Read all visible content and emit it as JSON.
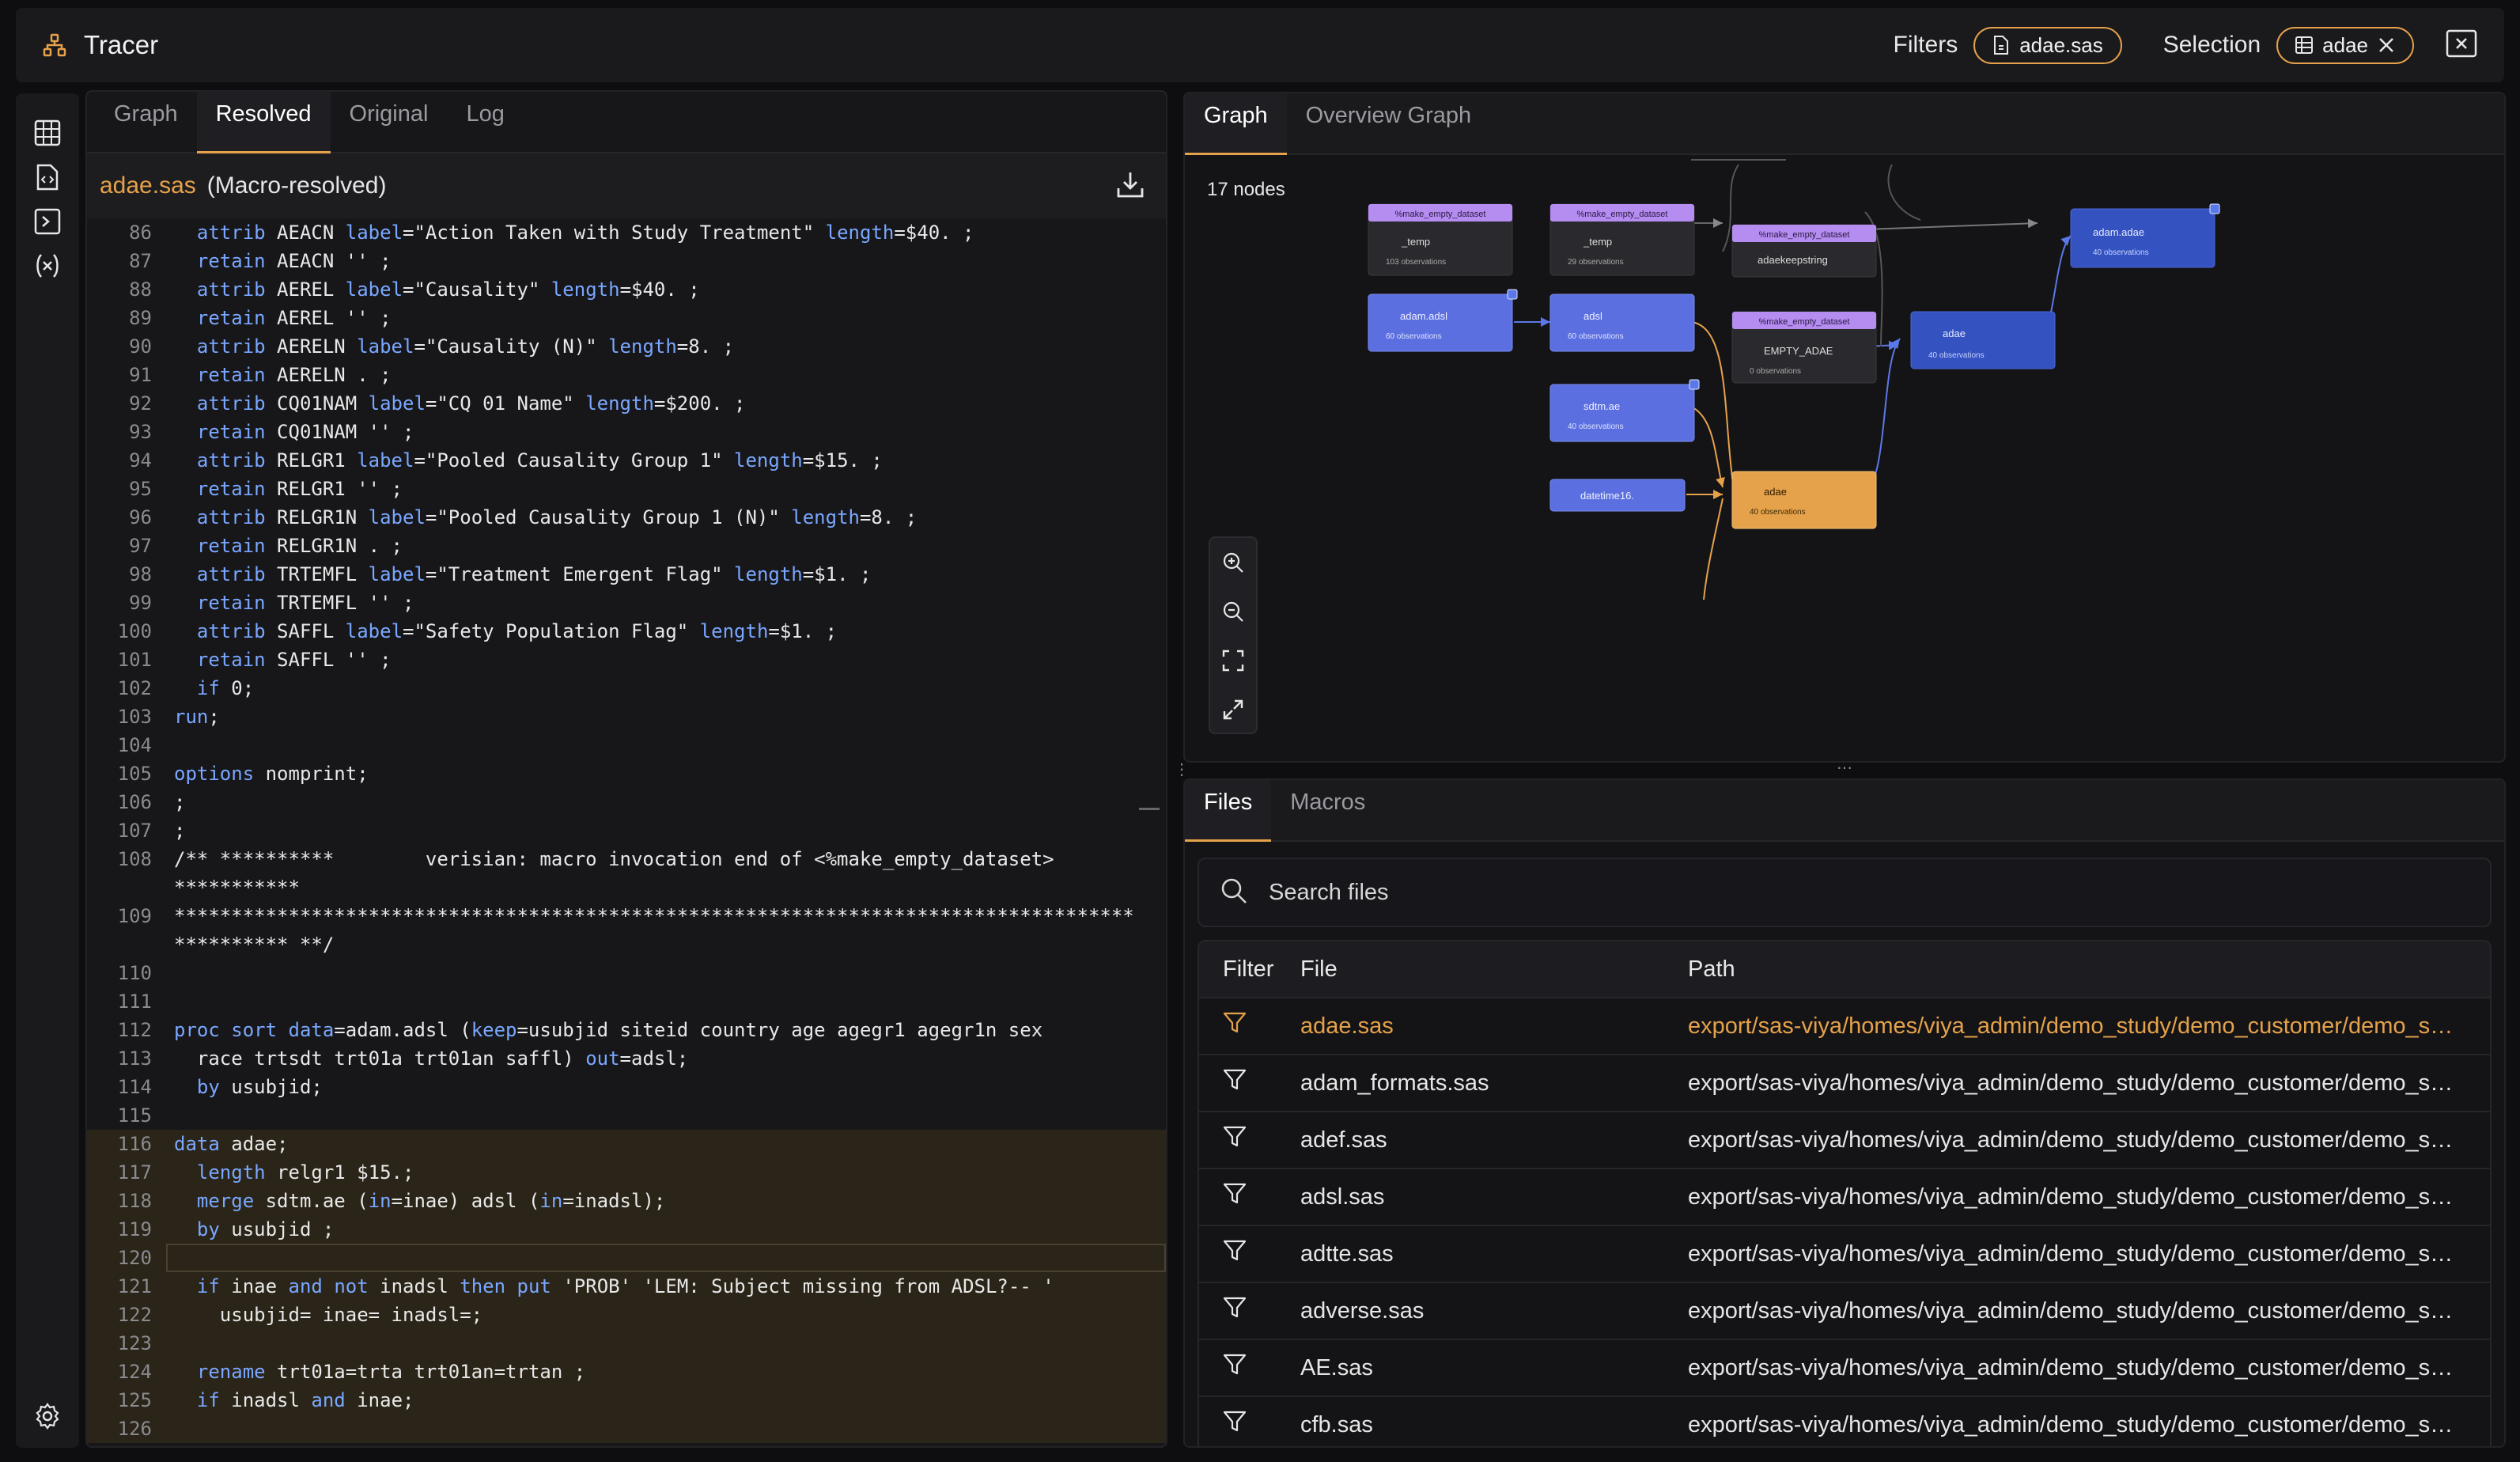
{
  "app": {
    "title": "Tracer",
    "filters_label": "Filters",
    "filter_value": "adae.sas",
    "selection_label": "Selection",
    "selection_value": "adae"
  },
  "code_panel": {
    "tabs": [
      "Graph",
      "Resolved",
      "Original",
      "Log"
    ],
    "active_tab": "Resolved",
    "file_name": "adae.sas",
    "file_suffix": "(Macro-resolved)"
  },
  "code_lines": [
    {
      "n": "86",
      "t": "  attrib AEACN label=\"Action Taken with Study Treatment\" length=$40. ;"
    },
    {
      "n": "87",
      "t": "  retain AEACN '' ;"
    },
    {
      "n": "88",
      "t": "  attrib AEREL label=\"Causality\" length=$40. ;"
    },
    {
      "n": "89",
      "t": "  retain AEREL '' ;"
    },
    {
      "n": "90",
      "t": "  attrib AERELN label=\"Causality (N)\" length=8. ;"
    },
    {
      "n": "91",
      "t": "  retain AERELN . ;"
    },
    {
      "n": "92",
      "t": "  attrib CQ01NAM label=\"CQ 01 Name\" length=$200. ;"
    },
    {
      "n": "93",
      "t": "  retain CQ01NAM '' ;"
    },
    {
      "n": "94",
      "t": "  attrib RELGR1 label=\"Pooled Causality Group 1\" length=$15. ;"
    },
    {
      "n": "95",
      "t": "  retain RELGR1 '' ;"
    },
    {
      "n": "96",
      "t": "  attrib RELGR1N label=\"Pooled Causality Group 1 (N)\" length=8. ;"
    },
    {
      "n": "97",
      "t": "  retain RELGR1N . ;"
    },
    {
      "n": "98",
      "t": "  attrib TRTEMFL label=\"Treatment Emergent Flag\" length=$1. ;"
    },
    {
      "n": "99",
      "t": "  retain TRTEMFL '' ;"
    },
    {
      "n": "100",
      "t": "  attrib SAFFL label=\"Safety Population Flag\" length=$1. ;"
    },
    {
      "n": "101",
      "t": "  retain SAFFL '' ;"
    },
    {
      "n": "102",
      "t": "  if 0;"
    },
    {
      "n": "103",
      "t": "run;"
    },
    {
      "n": "104",
      "t": ""
    },
    {
      "n": "105",
      "t": "options nomprint;"
    },
    {
      "n": "106",
      "t": ";"
    },
    {
      "n": "107",
      "t": ";"
    },
    {
      "n": "108",
      "t": "/** **********        verisian: macro invocation end of <%make_empty_dataset>        ***********"
    },
    {
      "n": "109",
      "t": "********************************************************************************************** **/"
    },
    {
      "n": "110",
      "t": ""
    },
    {
      "n": "111",
      "t": ""
    },
    {
      "n": "112",
      "t": "proc sort data=adam.adsl (keep=usubjid siteid country age agegr1 agegr1n sex"
    },
    {
      "n": "113",
      "t": "  race trtsdt trt01a trt01an saffl) out=adsl;"
    },
    {
      "n": "114",
      "t": "  by usubjid;"
    },
    {
      "n": "115",
      "t": ""
    },
    {
      "n": "116",
      "t": "data adae;"
    },
    {
      "n": "117",
      "t": "  length relgr1 $15.;"
    },
    {
      "n": "118",
      "t": "  merge sdtm.ae (in=inae) adsl (in=inadsl);"
    },
    {
      "n": "119",
      "t": "  by usubjid ;"
    },
    {
      "n": "120",
      "t": ""
    },
    {
      "n": "121",
      "t": "  if inae and not inadsl then put 'PROB' 'LEM: Subject missing from ADSL?-- '"
    },
    {
      "n": "122",
      "t": "    usubjid= inae= inadsl=;"
    },
    {
      "n": "123",
      "t": ""
    },
    {
      "n": "124",
      "t": "  rename trt01a=trta trt01an=trtan ;"
    },
    {
      "n": "125",
      "t": "  if inadsl and inae;"
    },
    {
      "n": "126",
      "t": ""
    }
  ],
  "graph_panel": {
    "tabs": [
      "Graph",
      "Overview Graph"
    ],
    "active_tab": "Graph",
    "node_count": "17 nodes",
    "nodes": [
      {
        "tag": "%make_empty_dataset",
        "name": "_temp",
        "obs": "103 observations"
      },
      {
        "tag": "%make_empty_dataset",
        "name": "_temp",
        "obs": "29 observations"
      },
      {
        "tag": "%make_empty_dataset",
        "name": "adaekeepstring",
        "obs": ""
      },
      {
        "tag": "",
        "name": "adam.adae",
        "obs": "40 observations"
      },
      {
        "tag": "",
        "name": "adam.adsl",
        "obs": "60 observations"
      },
      {
        "tag": "",
        "name": "adsl",
        "obs": "60 observations"
      },
      {
        "tag": "%make_empty_dataset",
        "name": "EMPTY_ADAE",
        "obs": "0 observations"
      },
      {
        "tag": "",
        "name": "adae",
        "obs": "40 observations"
      },
      {
        "tag": "",
        "name": "sdtm.ae",
        "obs": "40 observations"
      },
      {
        "tag": "",
        "name": "datetime16.",
        "obs": ""
      },
      {
        "tag": "",
        "name": "adae",
        "obs": "40 observations"
      }
    ],
    "colors": {
      "purple": "#b58cf0",
      "blue": "#5b6fe0",
      "darkblue": "#3452c0",
      "orange": "#e6a24a",
      "darknode": "#2a2a2e"
    }
  },
  "files_panel": {
    "tabs": [
      "Files",
      "Macros"
    ],
    "active_tab": "Files",
    "search_placeholder": "Search files",
    "columns": [
      "Filter",
      "File",
      "Path"
    ],
    "rows": [
      {
        "file": "adae.sas",
        "path": "export/sas-viya/homes/viya_admin/demo_study/demo_customer/demo_study/programs/adam/adae.sas",
        "selected": true
      },
      {
        "file": "adam_formats.sas",
        "path": "export/sas-viya/homes/viya_admin/demo_study/demo_customer/demo_study/programs/adam/adam_formats.sas",
        "selected": false
      },
      {
        "file": "adef.sas",
        "path": "export/sas-viya/homes/viya_admin/demo_study/demo_customer/demo_study/programs/adam/adef.sas",
        "selected": false
      },
      {
        "file": "adsl.sas",
        "path": "export/sas-viya/homes/viya_admin/demo_study/demo_customer/demo_study/programs/adam/adsl.sas",
        "selected": false
      },
      {
        "file": "adtte.sas",
        "path": "export/sas-viya/homes/viya_admin/demo_study/demo_customer/demo_study/programs/adam/adtte.sas",
        "selected": false
      },
      {
        "file": "adverse.sas",
        "path": "export/sas-viya/homes/viya_admin/demo_study/demo_customer/demo_study/programs/adam/adverse.sas",
        "selected": false
      },
      {
        "file": "AE.sas",
        "path": "export/sas-viya/homes/viya_admin/demo_study/demo_customer/demo_study/programs/sdtm/AE.sas",
        "selected": false
      },
      {
        "file": "cfb.sas",
        "path": "export/sas-viya/homes/viya_admin/demo_study/demo_customer/demo_study/programs/cfb.sas",
        "selected": false
      }
    ]
  }
}
